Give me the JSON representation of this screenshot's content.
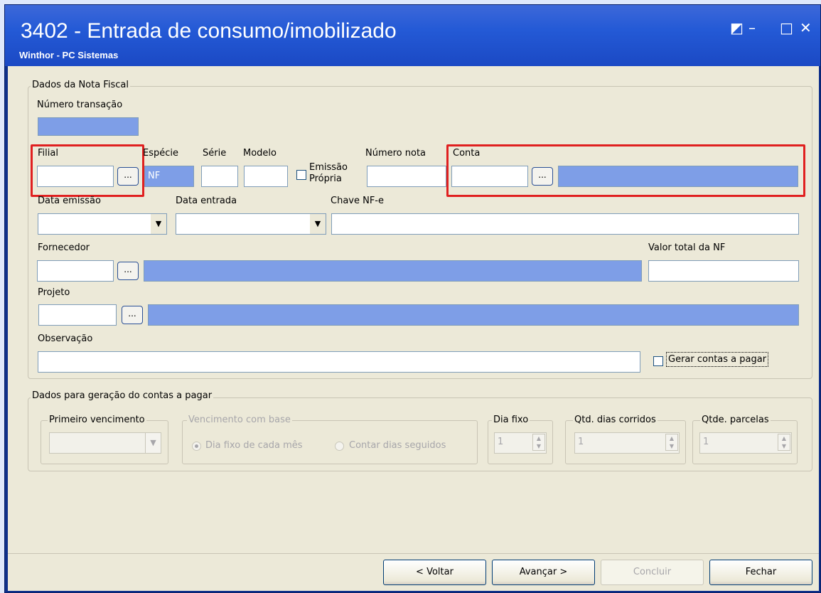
{
  "window": {
    "title": "3402 - Entrada de consumo/imobilizado",
    "subtitle": "Winthor - PC Sistemas",
    "controls": [
      "◩",
      "–",
      "□",
      "✕"
    ]
  },
  "nota_fiscal": {
    "legend": "Dados da Nota Fiscal",
    "numero_transacao_label": "Número transação",
    "filial_label": "Filial",
    "especie_label": "Espécie",
    "especie_value": "NF",
    "serie_label": "Série",
    "modelo_label": "Modelo",
    "emissao_propria_label_1": "Emissão",
    "emissao_propria_label_2": "Própria",
    "numero_nota_label": "Número nota",
    "conta_label": "Conta",
    "data_emissao_label": "Data emissão",
    "data_entrada_label": "Data entrada",
    "chave_label": "Chave NF-e",
    "fornecedor_label": "Fornecedor",
    "valor_total_label": "Valor total da NF",
    "projeto_label": "Projeto",
    "observacao_label": "Observação",
    "gerar_contas_label": "Gerar contas a pagar",
    "lookup_button": "..."
  },
  "contas_pagar": {
    "legend": "Dados para geração do contas a pagar",
    "primeiro_vencimento_legend": "Primeiro vencimento",
    "vencimento_base_legend": "Vencimento com base",
    "radio_dia_fixo": "Dia fixo de cada mês",
    "radio_contar_dias": "Contar dias seguidos",
    "dia_fixo_legend": "Dia fixo",
    "dia_fixo_value": "1",
    "qtd_dias_legend": "Qtd. dias corridos",
    "qtd_dias_value": "1",
    "qtde_parcelas_legend": "Qtde. parcelas",
    "qtde_parcelas_value": "1"
  },
  "buttons": {
    "voltar": "< Voltar",
    "avancar": "Avançar >",
    "concluir": "Concluir",
    "fechar": "Fechar"
  },
  "colors": {
    "titlebar": "#245ad6",
    "readonly_field": "#7e9ee7",
    "highlight": "#e02020"
  }
}
